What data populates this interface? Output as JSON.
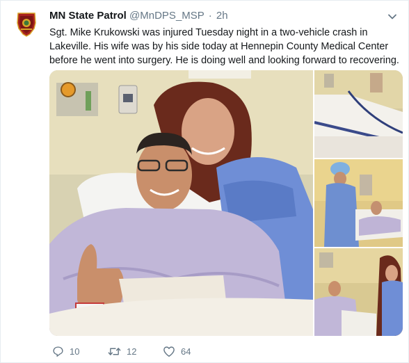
{
  "tweet": {
    "display_name": "MN State Patrol",
    "handle": "@MnDPS_MSP",
    "separator": "·",
    "time": "2h",
    "text": "Sgt. Mike Krukowski was injured Tuesday night in a two-vehicle crash in Lakeville. His wife was by his side today at Hennepin County Medical Center before he went into surgery. He is doing well and looking forward to recovering.",
    "avatar_icon": "state-patrol-badge-icon",
    "menu_icon": "chevron-down-icon"
  },
  "actions": {
    "reply_count": "10",
    "retweet_count": "12",
    "like_count": "64",
    "reply_icon": "reply-icon",
    "retweet_icon": "retweet-icon",
    "like_icon": "heart-icon"
  },
  "colors": {
    "name": "#14171a",
    "secondary": "#657786",
    "badge_red": "#a8221e",
    "badge_gold": "#d8a52a"
  }
}
